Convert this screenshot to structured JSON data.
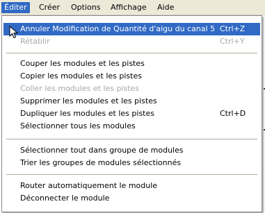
{
  "menubar": {
    "items": [
      {
        "label": "Éditer"
      },
      {
        "label": "Créer"
      },
      {
        "label": "Options"
      },
      {
        "label": "Affichage"
      },
      {
        "label": "Aide"
      }
    ]
  },
  "menu": {
    "items": [
      {
        "label": "Annuler Modification de Quantité d'aigu du canal 5",
        "shortcut": "Ctrl+Z"
      },
      {
        "label": "Rétablir",
        "shortcut": "Ctrl+Y"
      },
      {
        "label": "Couper les modules et les pistes"
      },
      {
        "label": "Copier les modules et les pistes"
      },
      {
        "label": "Coller les modules et les pistes"
      },
      {
        "label": "Supprimer les modules et les pistes"
      },
      {
        "label": "Dupliquer les modules et les pistes",
        "shortcut": "Ctrl+D"
      },
      {
        "label": "Sélectionner tous les modules"
      },
      {
        "label": "Sélectionner tout dans groupe de modules"
      },
      {
        "label": "Trier les groupes de modules sélectionnés"
      },
      {
        "label": "Router automatiquement le module"
      },
      {
        "label": "Déconnecter le module"
      }
    ]
  },
  "colors": {
    "highlight": "#316ac5",
    "menubar_bg": "#ece9d8",
    "disabled_text": "#a7a6aa"
  },
  "icons": {
    "cursor": "mouse-pointer-icon"
  }
}
